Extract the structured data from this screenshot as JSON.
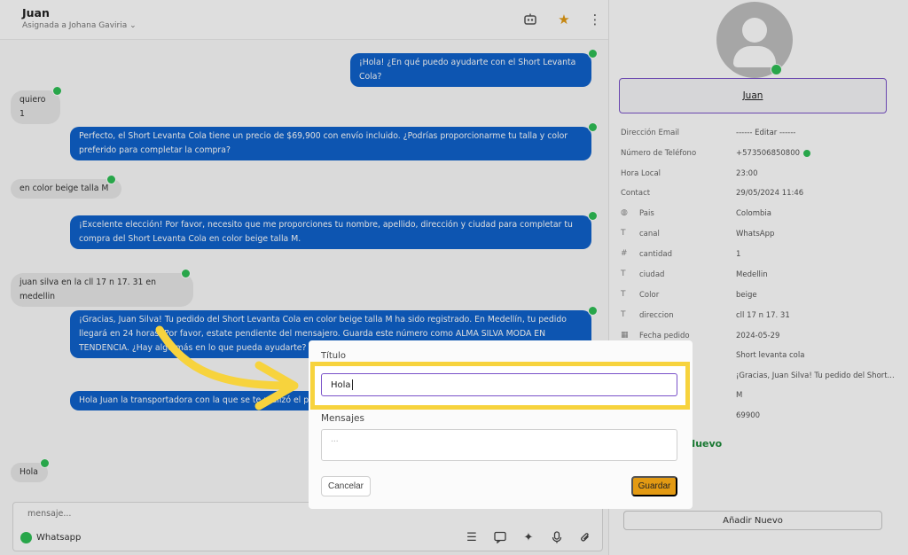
{
  "header": {
    "contact_name": "Juan",
    "assigned": "Asignada a Johana Gaviria ⌄"
  },
  "messages": [
    {
      "dir": "out",
      "text": "¡Hola! ¿En qué puedo ayudarte con el Short Levanta Cola?"
    },
    {
      "dir": "in",
      "text": "quiero 1"
    },
    {
      "dir": "out",
      "text": "Perfecto, el Short Levanta Cola tiene un precio de $69,900 con envío incluido. ¿Podrías proporcionarme tu talla y color preferido para completar la compra?"
    },
    {
      "dir": "in",
      "text": "en color beige talla M"
    },
    {
      "dir": "out",
      "text": "¡Excelente elección! Por favor, necesito que me proporciones tu nombre, apellido, dirección y ciudad para completar tu compra del Short Levanta Cola en color beige talla M."
    },
    {
      "dir": "in",
      "text": "juan silva en la cll 17 n 17. 31 en medellin"
    },
    {
      "dir": "out",
      "text": "¡Gracias, Juan Silva! Tu pedido del Short Levanta Cola en color beige talla M ha sido registrado. En Medellín, tu pedido llegará en 24 horas. Por favor, estate pendiente del mensajero. Guarda este número como ALMA SILVA MODA EN TENDENCIA. ¿Hay algo más en lo que pueda ayudarte?"
    },
    {
      "dir": "out",
      "text": "Hola Juan la transportadora con la que se te realizó el pedido no está disponible en este momento para poder resolverla?"
    },
    {
      "dir": "in",
      "text": "Hola"
    }
  ],
  "composer": {
    "placeholder": "mensaje...",
    "channel": "Whatsapp"
  },
  "contact_panel": {
    "name": "Juan",
    "rows": [
      {
        "label": "Dirección Email",
        "value": "------ Editar ------",
        "icon": ""
      },
      {
        "label": "Número de Teléfono",
        "value": "+573506850800",
        "icon": "",
        "verified": true
      },
      {
        "label": "Hora Local",
        "value": "23:00",
        "icon": ""
      },
      {
        "label": "Contact",
        "value": "29/05/2024 11:46",
        "icon": ""
      },
      {
        "label": "Pais",
        "value": "Colombia",
        "icon": "globe-icon"
      },
      {
        "label": "canal",
        "value": "WhatsApp",
        "icon": "text-field-icon"
      },
      {
        "label": "cantidad",
        "value": "1",
        "icon": "hash-icon"
      },
      {
        "label": "ciudad",
        "value": "Medellin",
        "icon": "text-field-icon"
      },
      {
        "label": "Color",
        "value": "beige",
        "icon": "text-field-icon"
      },
      {
        "label": "direccion",
        "value": "cll 17 n 17. 31",
        "icon": "text-field-icon"
      },
      {
        "label": "Fecha pedido",
        "value": "2024-05-29",
        "icon": "calendar-icon"
      },
      {
        "label": "",
        "value": "Short levanta cola",
        "icon": ""
      },
      {
        "label": "",
        "value": "¡Gracias, Juan Silva! Tu pedido del Short...",
        "icon": ""
      },
      {
        "label": "",
        "value": "M",
        "icon": ""
      },
      {
        "label": "",
        "value": "69900",
        "icon": ""
      }
    ],
    "nuevo_label": "Nuevo",
    "add_button": "Añadir Nuevo"
  },
  "modal": {
    "title_label": "Título",
    "title_value": "Hola",
    "messages_label": "Mensajes",
    "messages_placeholder": "...",
    "cancel": "Cancelar",
    "save": "Guardar"
  },
  "colors": {
    "outgoing_bubble": "#0f62cc",
    "incoming_bubble": "#e8e8e8",
    "highlight": "#f7d33d",
    "save_button": "#e39a13",
    "accent_border": "#7a52c9",
    "whatsapp": "#2fbf55"
  }
}
